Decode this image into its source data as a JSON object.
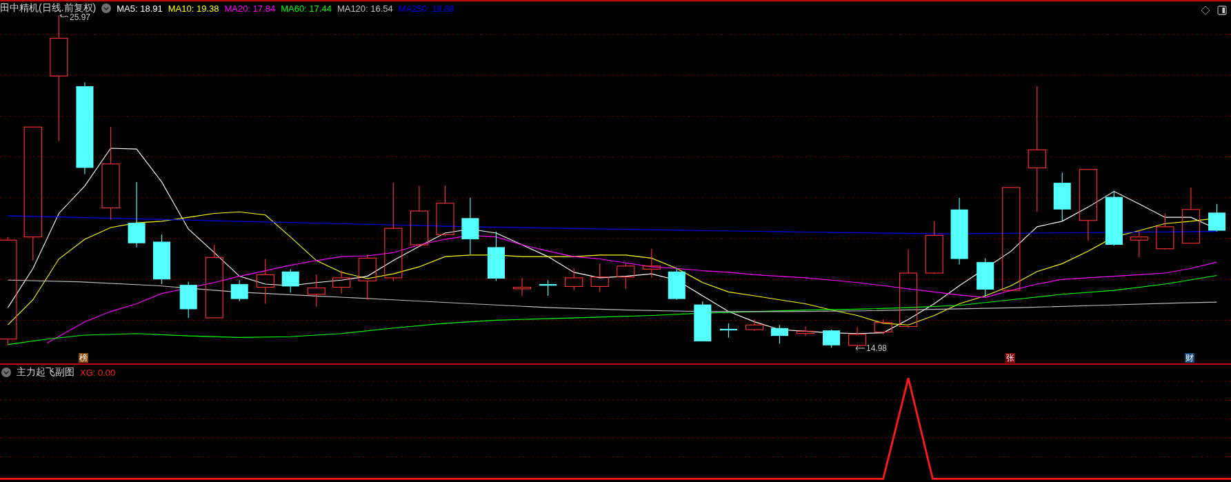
{
  "main_chart": {
    "title": "田中精机(日线.前复权)",
    "moving_averages": [
      {
        "label": "MA5: 18.91",
        "color": "#ffffff"
      },
      {
        "label": "MA10: 19.38",
        "color": "#ffff00"
      },
      {
        "label": "MA20: 17.84",
        "color": "#ff00ff"
      },
      {
        "label": "MA60: 17.44",
        "color": "#00ff00"
      },
      {
        "label": "MA120: 16.54",
        "color": "#c0c0c0"
      },
      {
        "label": "MA250: 18.88",
        "color": "#0000ff"
      }
    ],
    "high_label": "25.97",
    "low_label": "14.98",
    "markers": [
      {
        "label": "榜",
        "color": "#8b4a14"
      },
      {
        "label": "张",
        "color": "#8b0000"
      },
      {
        "label": "财",
        "color": "#1c4a80"
      }
    ]
  },
  "sub_chart": {
    "title": "主力起飞副图",
    "value_label": "XG: 0.00"
  }
}
